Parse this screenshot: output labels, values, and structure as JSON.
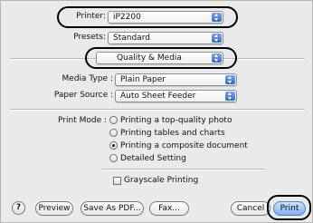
{
  "printer": {
    "label": "Printer:",
    "value": "iP2200"
  },
  "presets": {
    "label": "Presets:",
    "value": "Standard"
  },
  "pane_selector": {
    "value": "Quality & Media"
  },
  "media_type": {
    "label": "Media Type :",
    "value": "Plain Paper"
  },
  "paper_source": {
    "label": "Paper Source :",
    "value": "Auto Sheet Feeder"
  },
  "print_mode": {
    "label": "Print Mode :",
    "options": [
      {
        "label": "Printing a top-quality photo",
        "checked": false
      },
      {
        "label": "Printing tables and charts",
        "checked": false
      },
      {
        "label": "Printing a composite document",
        "checked": true
      },
      {
        "label": "Detailed Setting",
        "checked": false
      }
    ]
  },
  "grayscale": {
    "label": "Grayscale Printing",
    "checked": false
  },
  "buttons": {
    "help": "?",
    "preview": "Preview",
    "save_pdf": "Save As PDF...",
    "fax": "Fax...",
    "cancel": "Cancel",
    "print": "Print"
  },
  "colors": {
    "panel": "#eaeaea",
    "accent": "#2d6ccb",
    "default_button": "#7fb2ee"
  },
  "icons": {
    "popup_arrow": "updown-arrows-icon",
    "radio": "radio-icon",
    "checkbox": "checkbox-icon"
  }
}
